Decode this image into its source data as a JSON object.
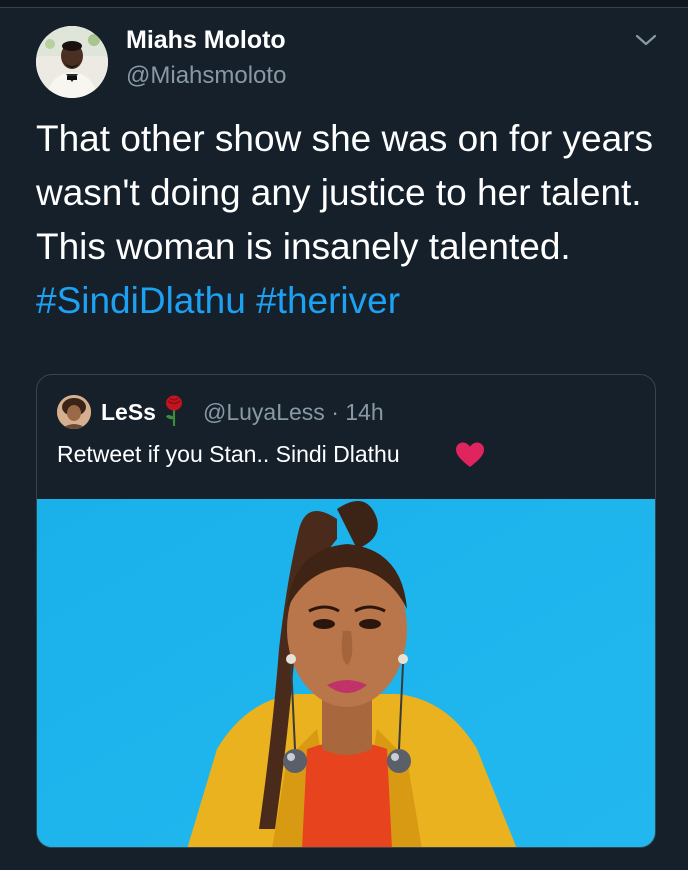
{
  "tweet": {
    "author_name": "Miahs Moloto",
    "author_handle": "@Miahsmoloto",
    "text_plain": "That other show she was on for years wasn't doing any justice to her talent. This woman is insanely talented.",
    "hashtags": [
      "#SindiDlathu",
      "#theriver"
    ],
    "menu_icon": "chevron-down-icon"
  },
  "quoted_tweet": {
    "author_name": "LeSs",
    "name_emoji": "rose-icon",
    "author_handle": "@LuyaLess",
    "separator": "·",
    "time": "14h",
    "text": "Retweet if you Stan.. Sindi Dlathu",
    "text_emoji": "heart-icon"
  },
  "colors": {
    "background": "#15202b",
    "text": "#ffffff",
    "secondary_text": "#8899a6",
    "link": "#1da1f2",
    "border": "#38444d",
    "photo_background": "#1db1e8"
  }
}
